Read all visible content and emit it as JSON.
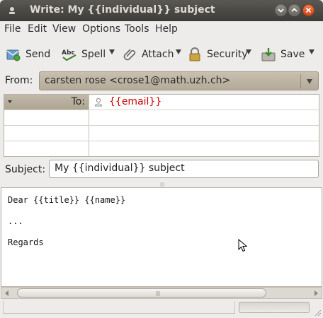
{
  "window": {
    "title": "Write: My {{individual}} subject"
  },
  "menubar": {
    "items": [
      "File",
      "Edit",
      "View",
      "Options",
      "Tools",
      "Help"
    ]
  },
  "toolbar": {
    "send_label": "Send",
    "spell_label": "Spell",
    "attach_label": "Attach",
    "security_label": "Security",
    "save_label": "Save"
  },
  "from": {
    "label": "From:",
    "value": "carsten rose <crose1@math.uzh.ch>"
  },
  "recipients": {
    "rows": [
      {
        "type": "To:",
        "value": "{{email}}"
      },
      {
        "type": "",
        "value": ""
      },
      {
        "type": "",
        "value": ""
      },
      {
        "type": "",
        "value": ""
      }
    ]
  },
  "subject": {
    "label": "Subject:",
    "value": "My {{individual}} subject"
  },
  "body": {
    "lines": [
      "Dear {{title}} {{name}}",
      "...",
      "Regards"
    ]
  },
  "icons": {
    "window": "email-icon",
    "send": "send-icon",
    "spell": "spellcheck-icon",
    "attach": "paperclip-icon",
    "security": "lock-icon",
    "save": "save-icon",
    "recipient": "person-icon"
  },
  "colors": {
    "titlebar": "#45443f",
    "from_select": "#bdb4a3",
    "recipient_text": "#cc0000",
    "close_button": "#e05a2c"
  }
}
